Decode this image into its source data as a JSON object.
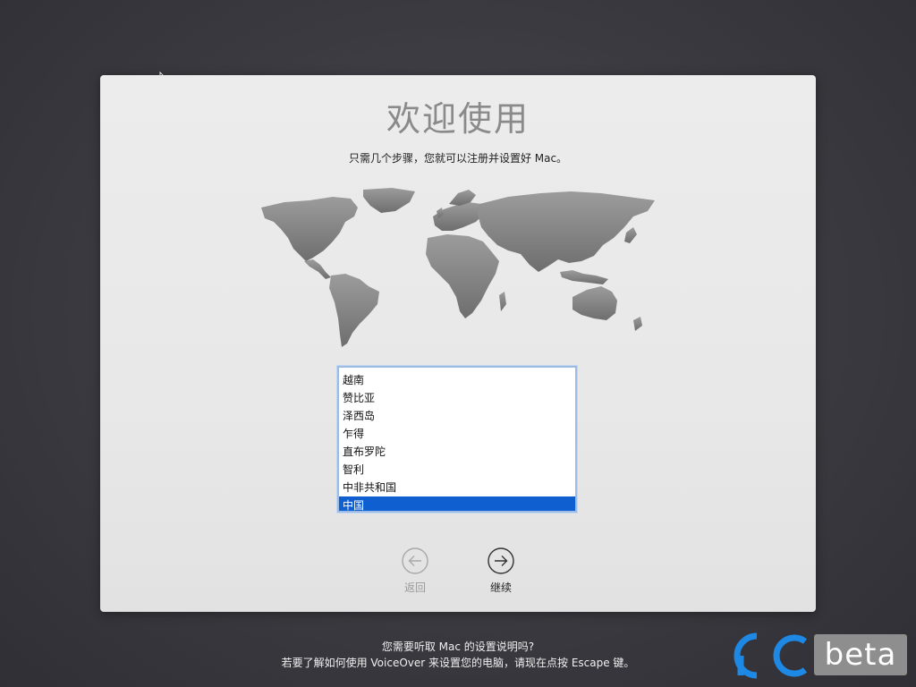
{
  "welcome": {
    "title": "欢迎使用",
    "subtitle": "只需几个步骤，您就可以注册并设置好 Mac。"
  },
  "country_list": {
    "items": [
      {
        "label": "越南",
        "selected": false
      },
      {
        "label": "赞比亚",
        "selected": false
      },
      {
        "label": "泽西岛",
        "selected": false
      },
      {
        "label": "乍得",
        "selected": false
      },
      {
        "label": "直布罗陀",
        "selected": false
      },
      {
        "label": "智利",
        "selected": false
      },
      {
        "label": "中非共和国",
        "selected": false
      },
      {
        "label": "中国",
        "selected": true
      }
    ],
    "accent_color": "#0f5fd0"
  },
  "navigation": {
    "back_label": "返回",
    "continue_label": "继续"
  },
  "voiceover": {
    "line1": "您需要听取 Mac 的设置说明吗?",
    "line2": "若要了解如何使用 VoiceOver 来设置您的电脑，请现在点按 Escape 键。"
  },
  "watermark": {
    "text": "beta"
  }
}
